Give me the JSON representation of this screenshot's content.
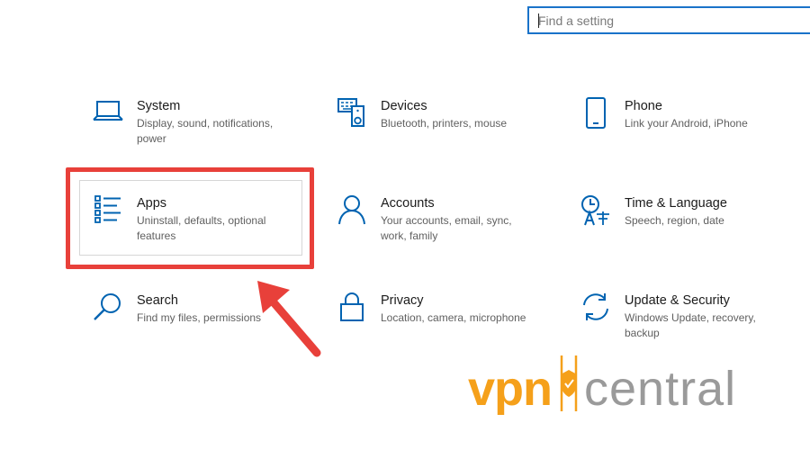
{
  "search": {
    "placeholder": "Find a setting"
  },
  "tiles": [
    {
      "id": "system",
      "title": "System",
      "desc_lines": [
        "Display, sound, notifications,",
        "power"
      ],
      "icon": "laptop-icon"
    },
    {
      "id": "devices",
      "title": "Devices",
      "desc_lines": [
        "Bluetooth, printers, mouse"
      ],
      "icon": "devices-icon"
    },
    {
      "id": "phone",
      "title": "Phone",
      "desc_lines": [
        "Link your Android, iPhone"
      ],
      "icon": "phone-icon"
    },
    {
      "id": "apps",
      "title": "Apps",
      "desc_lines": [
        "Uninstall, defaults, optional",
        "features"
      ],
      "icon": "apps-list-icon"
    },
    {
      "id": "accounts",
      "title": "Accounts",
      "desc_lines": [
        "Your accounts, email, sync,",
        "work, family"
      ],
      "icon": "person-icon"
    },
    {
      "id": "time-language",
      "title": "Time & Language",
      "desc_lines": [
        "Speech, region, date"
      ],
      "icon": "time-language-icon"
    },
    {
      "id": "search",
      "title": "Search",
      "desc_lines": [
        "Find my files, permissions"
      ],
      "icon": "magnifier-icon"
    },
    {
      "id": "privacy",
      "title": "Privacy",
      "desc_lines": [
        "Location, camera, microphone"
      ],
      "icon": "lock-icon"
    },
    {
      "id": "update-security",
      "title": "Update & Security",
      "desc_lines": [
        "Windows Update, recovery,",
        "backup"
      ],
      "icon": "sync-arrows-icon"
    }
  ],
  "logo": {
    "part1": "vpn",
    "part2": "central"
  },
  "colors": {
    "accent": "#0063b1",
    "highlight": "#e8403a",
    "logo_orange": "#f5a01a",
    "logo_gray": "#9a9a9a"
  }
}
